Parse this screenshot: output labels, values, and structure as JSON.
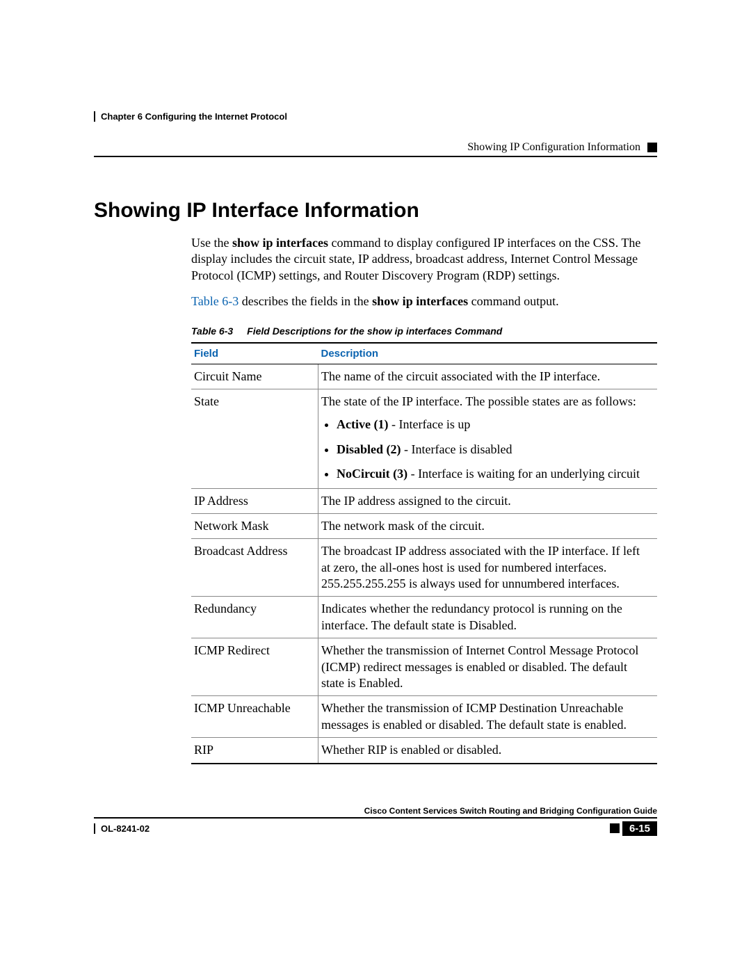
{
  "header": {
    "chapter": "Chapter 6      Configuring the Internet Protocol",
    "section": "Showing IP Configuration Information"
  },
  "title": "Showing IP Interface Information",
  "intro": {
    "pre": "Use the ",
    "cmd": "show ip interfaces",
    "post": " command to display configured IP interfaces on the CSS. The display includes the circuit state, IP address, broadcast address, Internet Control Message Protocol (ICMP) settings, and Router Discovery Program (RDP) settings."
  },
  "xref": {
    "link": "Table 6-3",
    "mid": " describes the fields in the ",
    "cmd": "show ip interfaces",
    "post": " command output."
  },
  "table": {
    "caption_num": "Table 6-3",
    "caption_text": "Field Descriptions for the show ip interfaces Command",
    "col1": "Field",
    "col2": "Description",
    "rows": [
      {
        "field": "Circuit Name",
        "desc": "The name of the circuit associated with the IP interface."
      },
      {
        "field": "State",
        "desc": "The state of the IP interface. The possible states are as follows:"
      },
      {
        "field": "IP Address",
        "desc": "The IP address assigned to the circuit."
      },
      {
        "field": "Network Mask",
        "desc": "The network mask of the circuit."
      },
      {
        "field": "Broadcast Address",
        "desc": "The broadcast IP address associated with the IP interface. If left at zero, the all-ones host is used for numbered interfaces. 255.255.255.255 is always used for unnumbered interfaces."
      },
      {
        "field": "Redundancy",
        "desc": "Indicates whether the redundancy protocol is running on the interface. The default state is Disabled."
      },
      {
        "field": "ICMP Redirect",
        "desc": "Whether the transmission of Internet Control Message Protocol (ICMP) redirect messages is enabled or disabled. The default state is Enabled."
      },
      {
        "field": "ICMP Unreachable",
        "desc": "Whether the transmission of ICMP Destination Unreachable messages is enabled or disabled. The default state is enabled."
      },
      {
        "field": "RIP",
        "desc": "Whether RIP is enabled or disabled."
      }
    ],
    "states": [
      {
        "label": "Active (1)",
        "text": " - Interface is up"
      },
      {
        "label": "Disabled (2)",
        "text": " - Interface is disabled"
      },
      {
        "label": "NoCircuit (3)",
        "text": " - Interface is waiting for an underlying circuit"
      }
    ]
  },
  "footer": {
    "guide": "Cisco Content Services Switch Routing and Bridging Configuration Guide",
    "doc": "OL-8241-02",
    "page": "6-15"
  },
  "chart_data": {
    "type": "table",
    "title": "Field Descriptions for the show ip interfaces Command",
    "columns": [
      "Field",
      "Description"
    ],
    "rows": [
      [
        "Circuit Name",
        "The name of the circuit associated with the IP interface."
      ],
      [
        "State",
        "The state of the IP interface. The possible states are as follows: Active (1) - Interface is up; Disabled (2) - Interface is disabled; NoCircuit (3) - Interface is waiting for an underlying circuit"
      ],
      [
        "IP Address",
        "The IP address assigned to the circuit."
      ],
      [
        "Network Mask",
        "The network mask of the circuit."
      ],
      [
        "Broadcast Address",
        "The broadcast IP address associated with the IP interface. If left at zero, the all-ones host is used for numbered interfaces. 255.255.255.255 is always used for unnumbered interfaces."
      ],
      [
        "Redundancy",
        "Indicates whether the redundancy protocol is running on the interface. The default state is Disabled."
      ],
      [
        "ICMP Redirect",
        "Whether the transmission of Internet Control Message Protocol (ICMP) redirect messages is enabled or disabled. The default state is Enabled."
      ],
      [
        "ICMP Unreachable",
        "Whether the transmission of ICMP Destination Unreachable messages is enabled or disabled. The default state is enabled."
      ],
      [
        "RIP",
        "Whether RIP is enabled or disabled."
      ]
    ]
  }
}
